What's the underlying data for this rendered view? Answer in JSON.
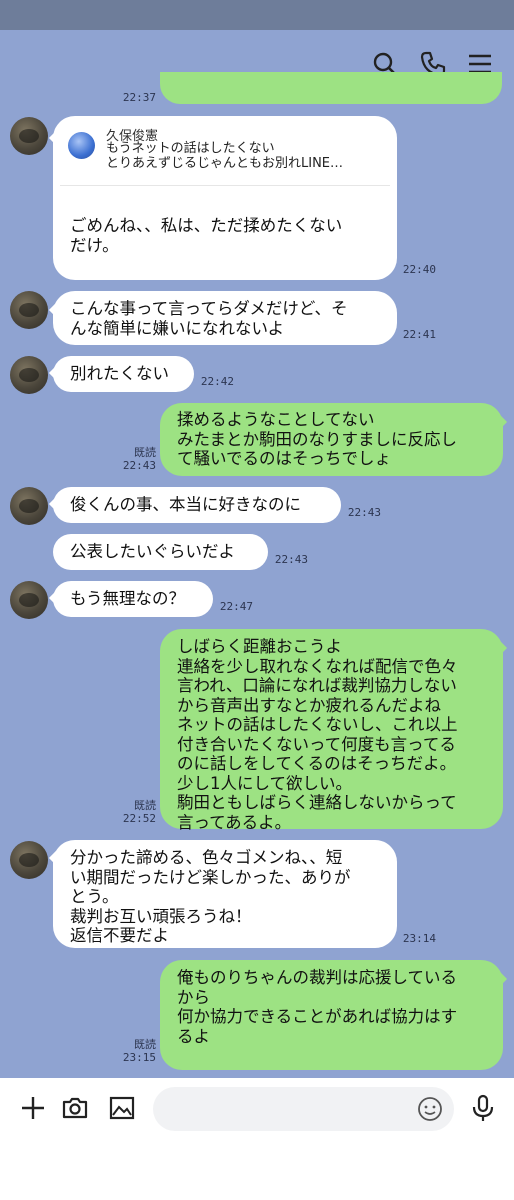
{
  "header": {
    "search_icon": "search-icon",
    "call_icon": "phone-icon",
    "menu_icon": "menu-icon"
  },
  "messages": {
    "top_partial_time": "22:37",
    "reply": {
      "name": "久保俊憲",
      "text": "もうネットの話はしたくない\nとりあえずじるじゃんともお別れLINE…",
      "body": "ごめんね、、私は、ただ揉めたくない\nだけ。",
      "time": "22:40"
    },
    "m1": {
      "text": "こんな事って言ってらダメだけど、そ\nんな簡単に嫌いになれないよ",
      "time": "22:41"
    },
    "m2": {
      "text": "別れたくない",
      "time": "22:42"
    },
    "m3": {
      "text": "揉めるようなことしてない\nみたまとか駒田のなりすましに反応し\nて騒いでるのはそっちでしょ",
      "read": "既読",
      "time": "22:43"
    },
    "m4": {
      "text": "俊くんの事、本当に好きなのに",
      "time": "22:43"
    },
    "m5": {
      "text": "公表したいぐらいだよ",
      "time": "22:43"
    },
    "m6": {
      "text": "もう無理なの？",
      "time": "22:47"
    },
    "m7": {
      "text": "しばらく距離おこうよ\n連絡を少し取れなくなれば配信で色々\n言われ、口論になれば裁判協力しない\nから音声出すなとか疲れるんだよね\nネットの話はしたくないし、これ以上\n付き合いたくないって何度も言ってる\nのに話しをしてくるのはそっちだよ。\n少し1人にして欲しい。\n駒田ともしばらく連絡しないからって\n言ってあるよ。",
      "read": "既読",
      "time": "22:52"
    },
    "m8": {
      "text": "分かった諦める、色々ゴメンね、、短\nい期間だったけど楽しかった、ありが\nとう。\n裁判お互い頑張ろうね！\n返信不要だよ",
      "time": "23:14"
    },
    "m9": {
      "text": "俺ものりちゃんの裁判は応援している\nから\n何か協力できることがあれば協力はす\nるよ",
      "read": "既読",
      "time": "23:15"
    }
  },
  "input_bar": {
    "plus_icon": "plus-icon",
    "camera_icon": "camera-icon",
    "image_icon": "image-icon",
    "emoji_icon": "emoji-icon",
    "mic_icon": "mic-icon",
    "placeholder": ""
  }
}
